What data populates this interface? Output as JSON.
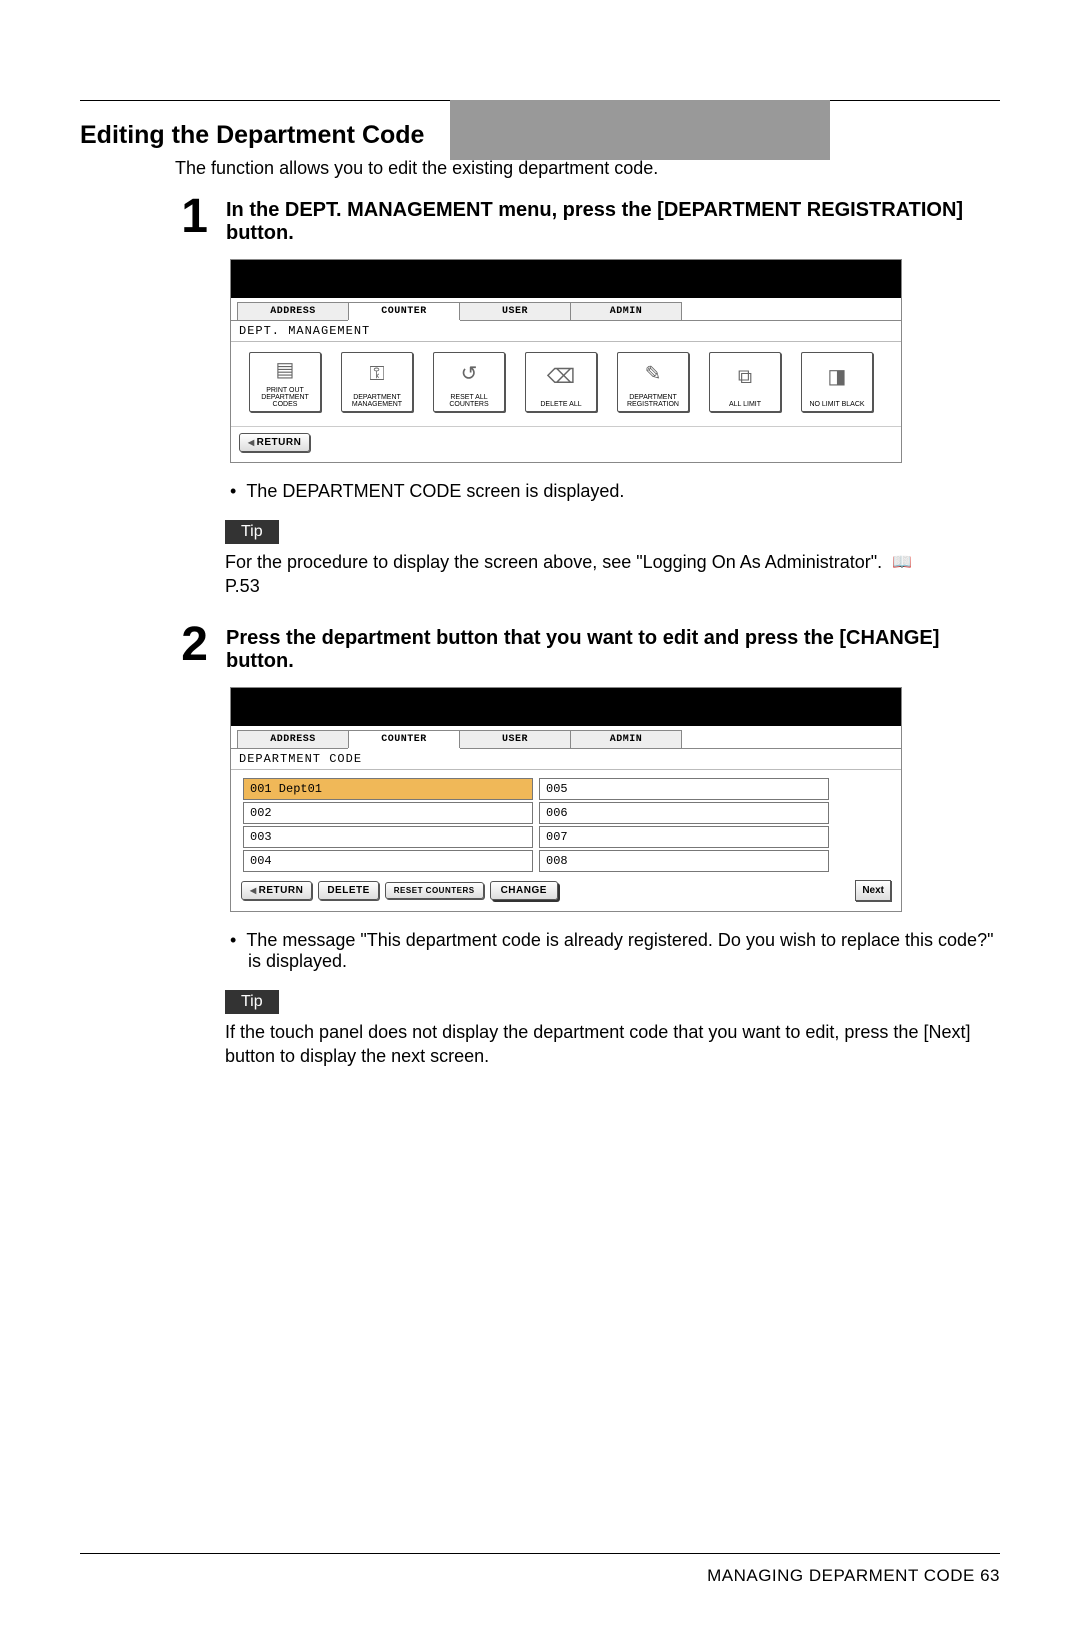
{
  "section_title": "Editing the Department Code",
  "intro": "The function allows you to edit the existing department code.",
  "steps": [
    {
      "num": "1",
      "text": "In the DEPT. MANAGEMENT menu, press the [DEPARTMENT REGISTRATION] button."
    },
    {
      "num": "2",
      "text": "Press the department button that you want to edit and press the [CHANGE] button."
    }
  ],
  "screen1": {
    "tabs": [
      "ADDRESS",
      "COUNTER",
      "USER",
      "ADMIN"
    ],
    "active_tab": "COUNTER",
    "sublabel": "DEPT. MANAGEMENT",
    "icons": [
      "PRINT OUT DEPARTMENT CODES",
      "DEPARTMENT MANAGEMENT",
      "RESET ALL COUNTERS",
      "DELETE ALL",
      "DEPARTMENT REGISTRATION",
      "ALL LIMIT",
      "NO LIMIT BLACK"
    ],
    "return_btn": "RETURN"
  },
  "bullet_after1": "The DEPARTMENT CODE screen is displayed.",
  "tip1_label": "Tip",
  "tip1_text_a": "For the procedure to display the screen above, see \"Logging On As Administrator\".",
  "tip1_text_b": "P.53",
  "screen2": {
    "tabs": [
      "ADDRESS",
      "COUNTER",
      "USER",
      "ADMIN"
    ],
    "active_tab": "COUNTER",
    "sublabel": "DEPARTMENT CODE",
    "left_col": [
      "001 Dept01",
      "002",
      "003",
      "004"
    ],
    "right_col": [
      "005",
      "006",
      "007",
      "008"
    ],
    "buttons": [
      "RETURN",
      "DELETE",
      "RESET COUNTERS",
      "CHANGE"
    ],
    "next_btn": "Next"
  },
  "bullet_after2": "The message \"This department code is already registered.  Do you wish to replace this code?\" is displayed.",
  "tip2_label": "Tip",
  "tip2_text": "If the touch panel does not display the department code that you want to edit, press the [Next] button to display the next screen.",
  "footer_text": "MANAGING DEPARMENT CODE    63"
}
